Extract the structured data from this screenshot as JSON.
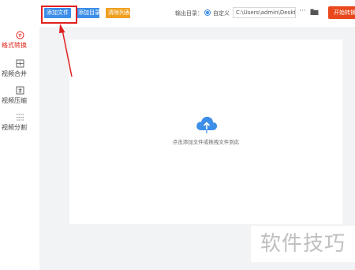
{
  "sidebar": {
    "items": [
      {
        "label": "格式转换",
        "icon": "convert-icon",
        "active": true
      },
      {
        "label": "视频合并",
        "icon": "merge-icon",
        "active": false
      },
      {
        "label": "视频压缩",
        "icon": "compress-icon",
        "active": false
      },
      {
        "label": "视频分割",
        "icon": "split-icon",
        "active": false
      }
    ]
  },
  "toolbar": {
    "add_file_label": "添加文件",
    "add_dir_label": "添加目录",
    "clear_list_label": "清除列表",
    "output_dir_label": "输出目录：",
    "custom_option_label": "自定义",
    "output_path_value": "C:\\Users\\admin\\Deskto",
    "more_label": "···",
    "start_label": "开始转换"
  },
  "main": {
    "drop_hint": "点击添加文件或拖拽文件到此"
  },
  "watermark": "软件技巧",
  "colors": {
    "accent": "#3d8ee8",
    "warning": "#f0a020",
    "primary_action": "#e8481c",
    "annotation": "#e02020"
  }
}
